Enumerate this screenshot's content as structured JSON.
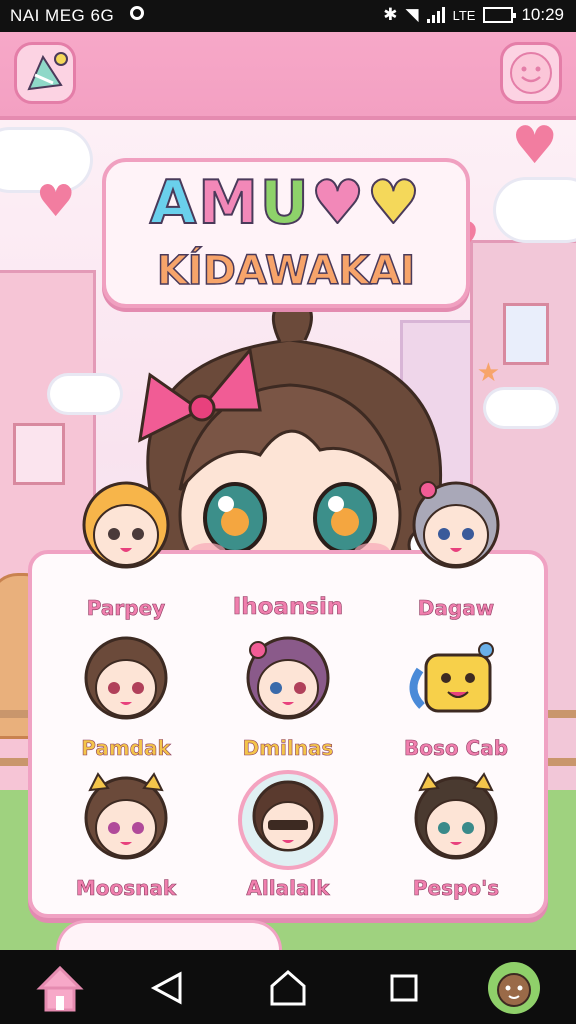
{
  "status_bar": {
    "left_text": "NAI MEG 6G",
    "battery_text": "LTE",
    "time": "10:29"
  },
  "app_bar": {
    "menu_icon": "party-hat-icon",
    "profile_icon": "smiley-face-icon"
  },
  "logo": {
    "line1": [
      "A",
      "M",
      "U",
      "♥",
      "♥"
    ],
    "line2": "KÍDAWAKAI"
  },
  "roster": {
    "characters": [
      {
        "name": "Parpey"
      },
      {
        "name": "Ihoansin"
      },
      {
        "name": "Dagaw"
      },
      {
        "name": "Pamdak"
      },
      {
        "name": "Dmilnas"
      },
      {
        "name": "Boso Cab"
      },
      {
        "name": "Moosnak"
      },
      {
        "name": "Allalalk"
      },
      {
        "name": "Pespo's"
      }
    ]
  },
  "nav": {
    "home_icon": "home-icon",
    "back_icon": "back-triangle-icon",
    "home_circle_icon": "home-circle-icon",
    "recents_icon": "recents-square-icon",
    "avatar_icon": "profile-avatar-icon"
  },
  "colors": {
    "accent_pink": "#f07fae",
    "panel_border": "#f0a2c3"
  }
}
